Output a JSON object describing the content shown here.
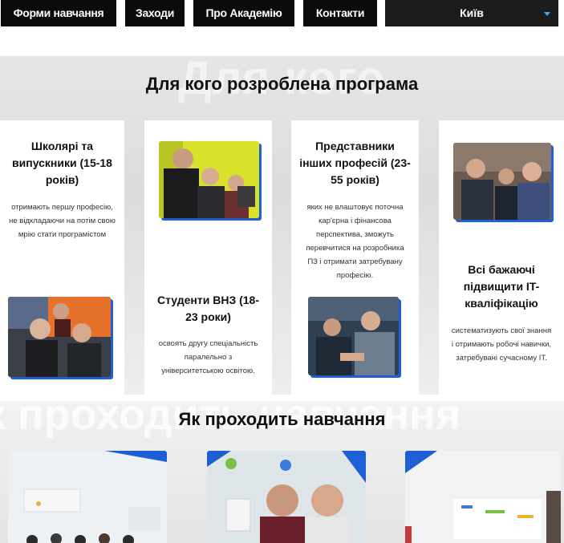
{
  "nav": {
    "items": [
      "Форми навчання",
      "Заходи",
      "Про Академію",
      "Контакти"
    ],
    "city": "Київ"
  },
  "audience": {
    "title": "Для кого розроблена програма",
    "ghost": "Для кого",
    "cards": [
      {
        "title": "Школярі та випускники (15-18 років)",
        "text": "отримають першу професію, не відкладаючи на потім свою мрію стати програмістом"
      },
      {
        "title": "Студенти ВНЗ (18-23 роки)",
        "text": "освоять другу спеціальність паралельно з університетською освітою."
      },
      {
        "title": "Представники інших професій (23-55 років)",
        "text": "яких не влаштовує поточна кар'єрна і фінансова перспектива, зможуть перевчитися на розробника ПЗ і отримати затребувану професію."
      },
      {
        "title": "Всі бажаючі підвищити IT-кваліфікацію",
        "text": "систематизують свої знання і отримають робочі навички, затребувані сучасному IT."
      }
    ]
  },
  "learning": {
    "title": "Як проходить навчання",
    "ghost": "к проходить навчання"
  },
  "colors": {
    "nav_bg": "#0b0b0b",
    "accent": "#1f5fd6",
    "chevron": "#3aa8ff"
  }
}
